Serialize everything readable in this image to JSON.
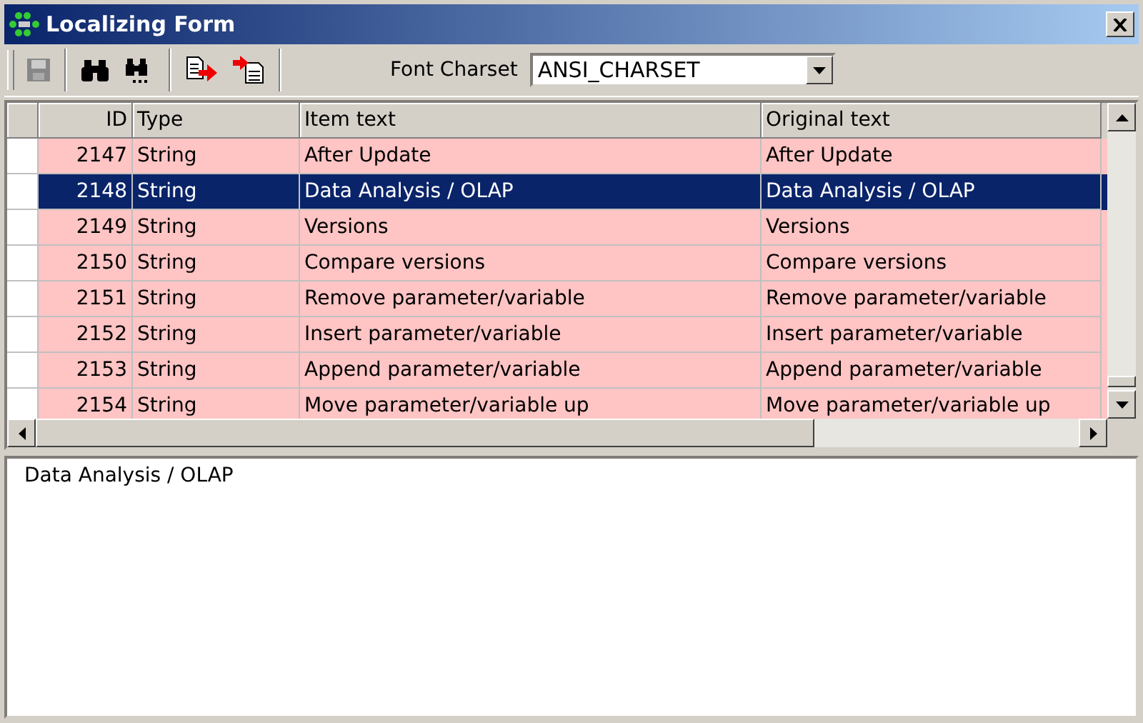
{
  "window": {
    "title": "Localizing Form"
  },
  "toolbar": {
    "font_charset_label": "Font Charset",
    "font_charset": "ANSI_CHARSET"
  },
  "table": {
    "columns": [
      "ID",
      "Type",
      "Item text",
      "Original text"
    ],
    "rows": [
      {
        "id": "2147",
        "type": "String",
        "item_text": "After Update",
        "original_text": "After Update",
        "selected": false
      },
      {
        "id": "2148",
        "type": "String",
        "item_text": "Data Analysis / OLAP",
        "original_text": "Data Analysis / OLAP",
        "selected": true
      },
      {
        "id": "2149",
        "type": "String",
        "item_text": "Versions",
        "original_text": "Versions",
        "selected": false
      },
      {
        "id": "2150",
        "type": "String",
        "item_text": "Compare versions",
        "original_text": "Compare versions",
        "selected": false
      },
      {
        "id": "2151",
        "type": "String",
        "item_text": "Remove parameter/variable",
        "original_text": "Remove parameter/variable",
        "selected": false
      },
      {
        "id": "2152",
        "type": "String",
        "item_text": "Insert parameter/variable",
        "original_text": "Insert parameter/variable",
        "selected": false
      },
      {
        "id": "2153",
        "type": "String",
        "item_text": "Append parameter/variable",
        "original_text": "Append parameter/variable",
        "selected": false
      },
      {
        "id": "2154",
        "type": "String",
        "item_text": "Move parameter/variable up",
        "original_text": "Move parameter/variable up",
        "selected": false
      }
    ]
  },
  "editor": {
    "value": "Data Analysis / OLAP"
  }
}
